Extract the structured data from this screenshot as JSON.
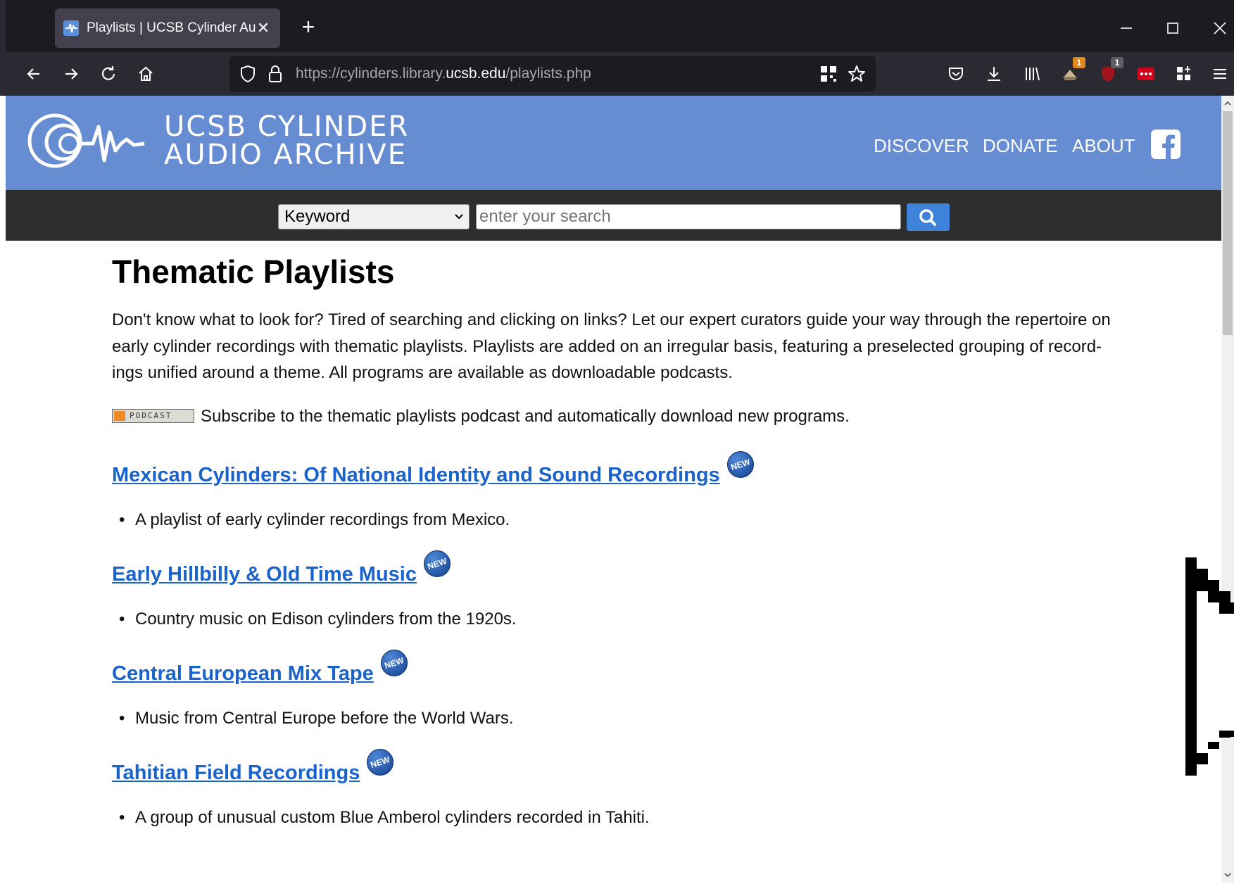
{
  "browser": {
    "tab_title": "Playlists | UCSB Cylinder Audio Archive",
    "tab_close": "✕",
    "new_tab": "+",
    "url_prefix": "https://cylinders.library.",
    "url_domain": "ucsb.edu",
    "url_path": "/playlists.php",
    "extension_badges": {
      "extension_a": "1",
      "ublock": "1"
    },
    "window_controls": {
      "minimize": "—",
      "maximize": "☐",
      "close": "✕"
    }
  },
  "site": {
    "logo_line1": "UCSB CYLINDER",
    "logo_line2": "AUDIO ARCHIVE",
    "nav": {
      "discover": "DISCOVER",
      "donate": "DONATE",
      "about": "ABOUT"
    },
    "search": {
      "type_selected": "Keyword",
      "placeholder": "enter your search"
    },
    "colors": {
      "header": "#668cd2",
      "search_bar": "#2e2e2e",
      "link": "#1a63cc"
    }
  },
  "page": {
    "title": "Thematic Playlists",
    "intro_line1": "Don't know what to look for? Tired of searching and clicking on links? Let our expert curators guide your way through the repertoire on",
    "intro_line2": "early cylinder recordings with thematic playlists. Playlists are added on an irregular basis, featuring a preselected grouping of record-",
    "intro_line3": "ings unified around a theme. All programs are available as downloadable podcasts.",
    "podcast_badge": "PODCAST",
    "podcast_text": "Subscribe to the thematic playlists podcast and automatically download new programs.",
    "new_label": "NEW",
    "playlists": [
      {
        "title": "Mexican Cylinders: Of National Identity and Sound Recordings",
        "description": "A playlist of early cylinder recordings from Mexico."
      },
      {
        "title": "Early Hillbilly & Old Time Music",
        "description": "Country music on Edison cylinders from the 1920s."
      },
      {
        "title": "Central European Mix Tape",
        "description": "Music from Central Europe before the World Wars."
      },
      {
        "title": "Tahitian Field Recordings",
        "description": "A group of unusual custom Blue Amberol cylinders recorded in Tahiti."
      }
    ]
  }
}
